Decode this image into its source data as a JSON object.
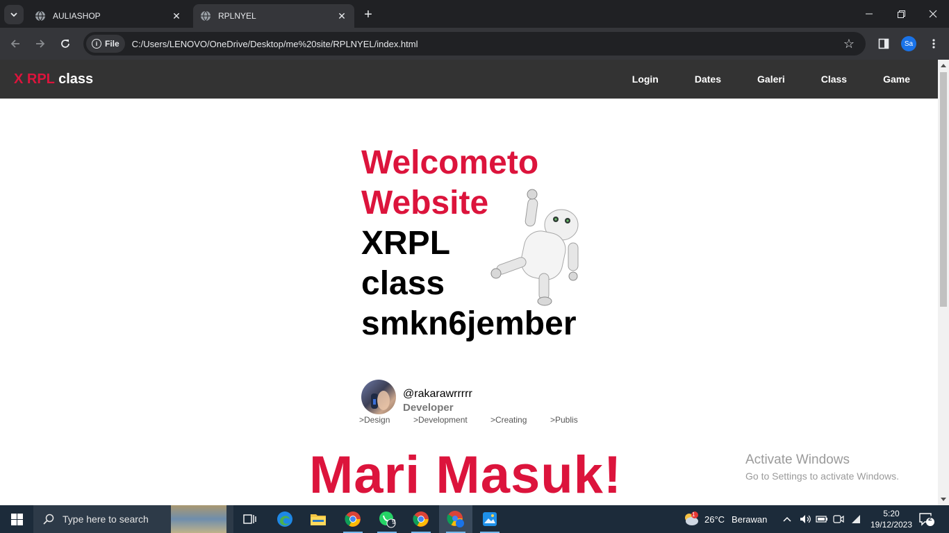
{
  "browser": {
    "tabs": [
      {
        "title": "AULIASHOP",
        "active": false
      },
      {
        "title": "RPLNYEL",
        "active": true
      }
    ],
    "site_chip": "File",
    "url": "C:/Users/LENOVO/OneDrive/Desktop/me%20site/RPLNYEL/index.html",
    "profile_initials": "Sa"
  },
  "site": {
    "logo_accent": "X RPL",
    "logo_rest": "class",
    "nav": [
      "Login",
      "Dates",
      "Galeri",
      "Class",
      "Game"
    ],
    "hero": {
      "line1": "Welcometo",
      "line2": "Website",
      "line3": "XRPL",
      "line4": "class",
      "line5": "smkn6jember"
    },
    "profile": {
      "handle": "@rakarawrrrrr",
      "role": "Developer",
      "skills": [
        ">Design",
        ">Development",
        ">Creating",
        ">Publis"
      ]
    },
    "cta": "Mari Masuk!",
    "accent_color": "#dc143c"
  },
  "watermark": {
    "title": "Activate Windows",
    "subtitle": "Go to Settings to activate Windows."
  },
  "taskbar": {
    "search_placeholder": "Type here to search",
    "weather_temp": "26°C",
    "weather_desc": "Berawan",
    "weather_badge": "1",
    "whatsapp_badge": "9",
    "time": "5:20",
    "date": "19/12/2023",
    "notifications": "2"
  }
}
